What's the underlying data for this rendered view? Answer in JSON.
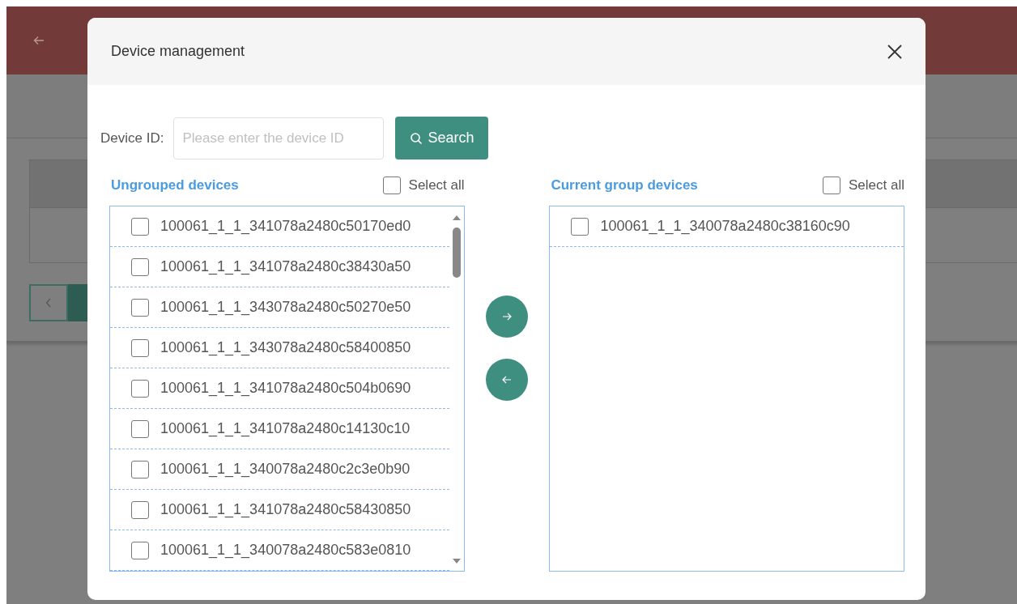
{
  "dialog": {
    "title": "Device management"
  },
  "search": {
    "label": "Device ID:",
    "placeholder": "Please enter the device ID",
    "button": "Search"
  },
  "ungrouped": {
    "title": "Ungrouped devices",
    "select_all": {
      "label": "Select all",
      "checked": false
    },
    "items": [
      {
        "label": "100061_1_1_341078a2480c50170ed0",
        "checked": false
      },
      {
        "label": "100061_1_1_341078a2480c38430a50",
        "checked": false
      },
      {
        "label": "100061_1_1_343078a2480c50270e50",
        "checked": false
      },
      {
        "label": "100061_1_1_343078a2480c58400850",
        "checked": false
      },
      {
        "label": "100061_1_1_341078a2480c504b0690",
        "checked": false
      },
      {
        "label": "100061_1_1_341078a2480c14130c10",
        "checked": false
      },
      {
        "label": "100061_1_1_340078a2480c2c3e0b90",
        "checked": false
      },
      {
        "label": "100061_1_1_341078a2480c58430850",
        "checked": false
      },
      {
        "label": "100061_1_1_340078a2480c583e0810",
        "checked": false
      }
    ]
  },
  "current": {
    "title": "Current group devices",
    "select_all": {
      "label": "Select all",
      "checked": false
    },
    "items": [
      {
        "label": "100061_1_1_340078a2480c38160c90",
        "checked": false
      }
    ]
  }
}
